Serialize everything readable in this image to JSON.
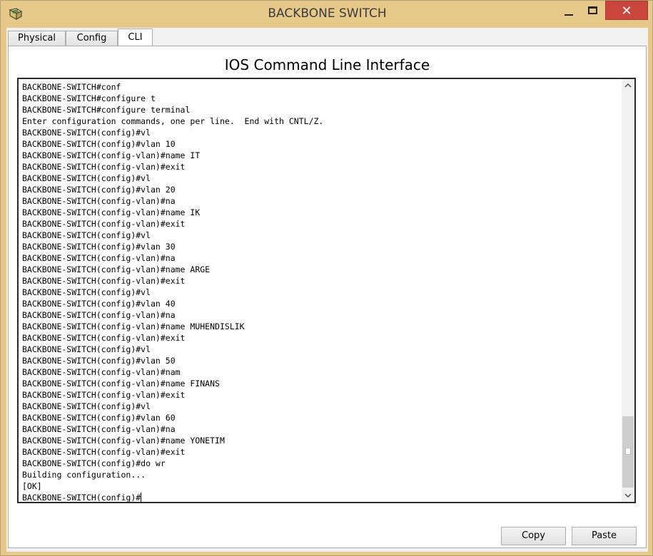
{
  "window": {
    "title": "BACKBONE SWITCH",
    "minimize_glyph": "",
    "close_glyph": "✕",
    "icon": "packet-tracer-switch-icon"
  },
  "tabs": [
    {
      "label": "Physical",
      "active": false
    },
    {
      "label": "Config",
      "active": false
    },
    {
      "label": "CLI",
      "active": true
    }
  ],
  "cli": {
    "heading": "IOS Command Line Interface",
    "lines": [
      "BACKBONE-SWITCH#conf",
      "BACKBONE-SWITCH#configure t",
      "BACKBONE-SWITCH#configure terminal",
      "Enter configuration commands, one per line.  End with CNTL/Z.",
      "BACKBONE-SWITCH(config)#vl",
      "BACKBONE-SWITCH(config)#vlan 10",
      "BACKBONE-SWITCH(config-vlan)#name IT",
      "BACKBONE-SWITCH(config-vlan)#exit",
      "BACKBONE-SWITCH(config)#vl",
      "BACKBONE-SWITCH(config)#vlan 20",
      "BACKBONE-SWITCH(config-vlan)#na",
      "BACKBONE-SWITCH(config-vlan)#name IK",
      "BACKBONE-SWITCH(config-vlan)#exit",
      "BACKBONE-SWITCH(config)#vl",
      "BACKBONE-SWITCH(config)#vlan 30",
      "BACKBONE-SWITCH(config-vlan)#na",
      "BACKBONE-SWITCH(config-vlan)#name ARGE",
      "BACKBONE-SWITCH(config-vlan)#exit",
      "BACKBONE-SWITCH(config)#vl",
      "BACKBONE-SWITCH(config)#vlan 40",
      "BACKBONE-SWITCH(config-vlan)#na",
      "BACKBONE-SWITCH(config-vlan)#name MUHENDISLIK",
      "BACKBONE-SWITCH(config-vlan)#exit",
      "BACKBONE-SWITCH(config)#vl",
      "BACKBONE-SWITCH(config)#vlan 50",
      "BACKBONE-SWITCH(config-vlan)#nam",
      "BACKBONE-SWITCH(config-vlan)#name FINANS",
      "BACKBONE-SWITCH(config-vlan)#exit",
      "BACKBONE-SWITCH(config)#vl",
      "BACKBONE-SWITCH(config)#vlan 60",
      "BACKBONE-SWITCH(config-vlan)#na",
      "BACKBONE-SWITCH(config-vlan)#name YONETIM",
      "BACKBONE-SWITCH(config-vlan)#exit",
      "BACKBONE-SWITCH(config)#do wr",
      "Building configuration...",
      "[OK]",
      "BACKBONE-SWITCH(config)#"
    ],
    "scroll_position": 0.95
  },
  "buttons": {
    "copy_label": "Copy",
    "paste_label": "Paste"
  },
  "colors": {
    "frame": "#e6c98a",
    "close_button": "#c9463d"
  }
}
